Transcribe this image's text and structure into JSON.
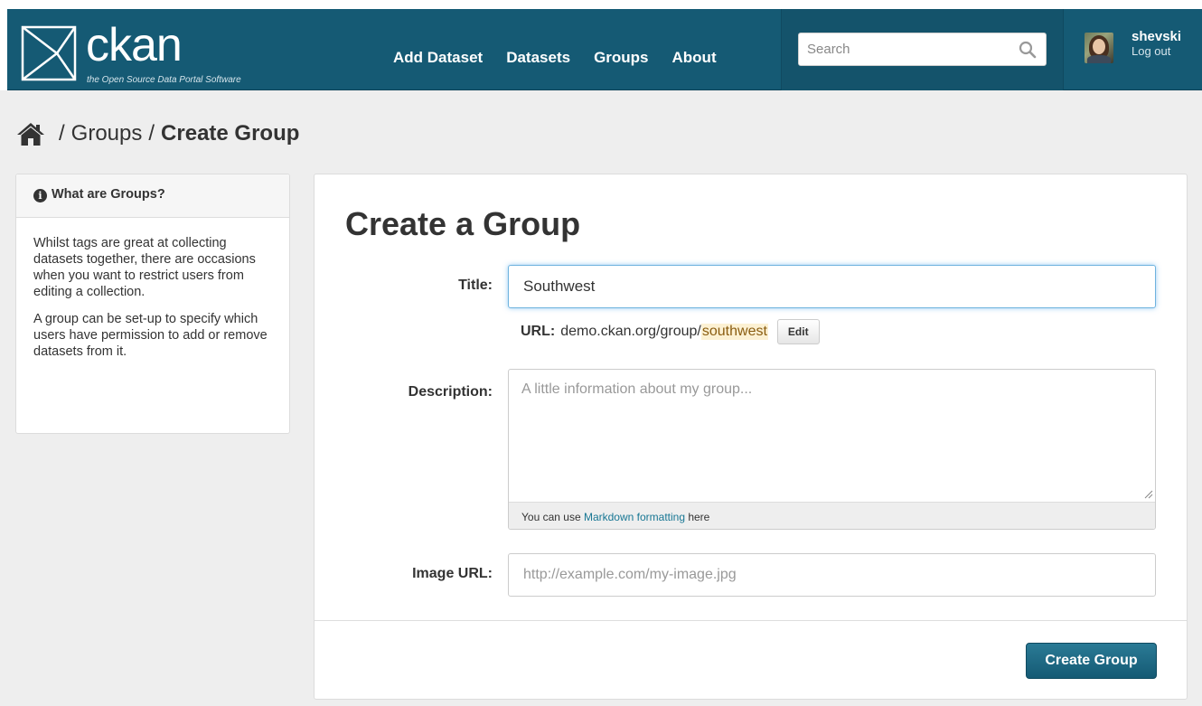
{
  "brand": {
    "name": "ckan",
    "tagline": "the Open Source Data Portal Software"
  },
  "nav": {
    "items": [
      {
        "label": "Add Dataset"
      },
      {
        "label": "Datasets"
      },
      {
        "label": "Groups"
      },
      {
        "label": "About"
      }
    ]
  },
  "search": {
    "placeholder": "Search"
  },
  "user": {
    "name": "shevski",
    "logout": "Log out"
  },
  "breadcrumb": {
    "sep": "/",
    "groups": "Groups",
    "current": "Create Group"
  },
  "sidebar": {
    "title": "What are Groups?",
    "paragraphs": [
      "Whilst tags are great at collecting datasets together, there are occasions when you want to restrict users from editing a collection.",
      "A group can be set-up to specify which users have permission to add or remove datasets from it."
    ]
  },
  "form": {
    "heading": "Create a Group",
    "title_label": "Title:",
    "title_value": "Southwest",
    "url_label": "URL:",
    "url_base": "demo.ckan.org/group/",
    "url_slug": "southwest",
    "edit_label": "Edit",
    "description_label": "Description:",
    "description_placeholder": "A little information about my group...",
    "markdown_prefix": "You can use ",
    "markdown_link": "Markdown formatting",
    "markdown_suffix": " here",
    "image_label": "Image URL:",
    "image_placeholder": "http://example.com/my-image.jpg",
    "submit_label": "Create Group"
  },
  "colors": {
    "header": "#155a74",
    "accent_link": "#187794",
    "slug_highlight": "#fcf1d3"
  },
  "icons": [
    "ckan-logo-icon",
    "search-icon",
    "home-icon",
    "info-icon",
    "resize-grip-icon"
  ]
}
